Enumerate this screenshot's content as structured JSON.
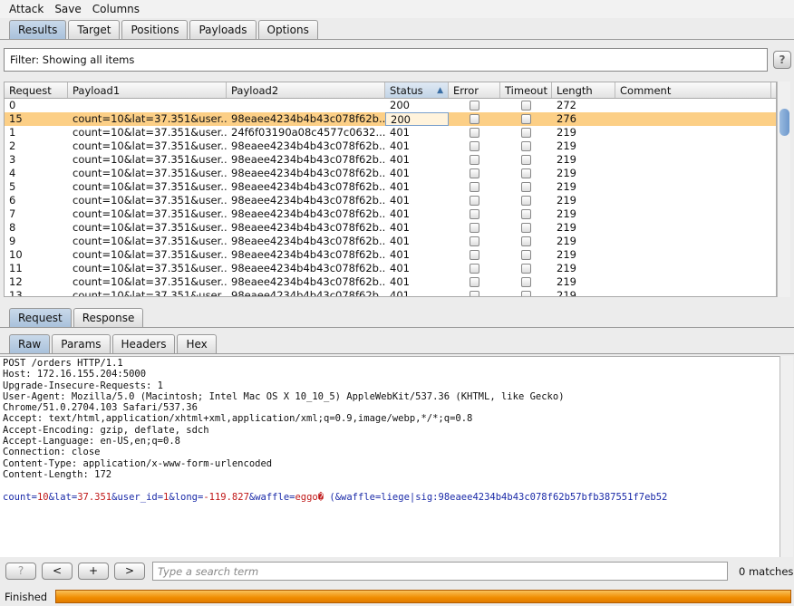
{
  "menu": [
    "Attack",
    "Save",
    "Columns"
  ],
  "main_tabs": [
    {
      "label": "Results",
      "selected": true
    },
    {
      "label": "Target"
    },
    {
      "label": "Positions"
    },
    {
      "label": "Payloads"
    },
    {
      "label": "Options"
    }
  ],
  "filter": "Filter: Showing all items",
  "help_label": "?",
  "table": {
    "columns": [
      "Request",
      "Payload1",
      "Payload2",
      "Status",
      "Error",
      "Timeout",
      "Length",
      "Comment"
    ],
    "sorted_column": "Status",
    "rows": [
      {
        "request": "0",
        "payload1": "",
        "payload2": "",
        "status": "200",
        "length": "272"
      },
      {
        "request": "15",
        "payload1": "count=10&lat=37.351&user...",
        "payload2": "98eaee4234b4b43c078f62b...",
        "status": "200",
        "length": "276",
        "selected": true
      },
      {
        "request": "1",
        "payload1": "count=10&lat=37.351&user...",
        "payload2": "24f6f03190a08c4577c0632...",
        "status": "401",
        "length": "219"
      },
      {
        "request": "2",
        "payload1": "count=10&lat=37.351&user...",
        "payload2": "98eaee4234b4b43c078f62b...",
        "status": "401",
        "length": "219"
      },
      {
        "request": "3",
        "payload1": "count=10&lat=37.351&user...",
        "payload2": "98eaee4234b4b43c078f62b...",
        "status": "401",
        "length": "219"
      },
      {
        "request": "4",
        "payload1": "count=10&lat=37.351&user...",
        "payload2": "98eaee4234b4b43c078f62b...",
        "status": "401",
        "length": "219"
      },
      {
        "request": "5",
        "payload1": "count=10&lat=37.351&user...",
        "payload2": "98eaee4234b4b43c078f62b...",
        "status": "401",
        "length": "219"
      },
      {
        "request": "6",
        "payload1": "count=10&lat=37.351&user...",
        "payload2": "98eaee4234b4b43c078f62b...",
        "status": "401",
        "length": "219"
      },
      {
        "request": "7",
        "payload1": "count=10&lat=37.351&user...",
        "payload2": "98eaee4234b4b43c078f62b...",
        "status": "401",
        "length": "219"
      },
      {
        "request": "8",
        "payload1": "count=10&lat=37.351&user...",
        "payload2": "98eaee4234b4b43c078f62b...",
        "status": "401",
        "length": "219"
      },
      {
        "request": "9",
        "payload1": "count=10&lat=37.351&user...",
        "payload2": "98eaee4234b4b43c078f62b...",
        "status": "401",
        "length": "219"
      },
      {
        "request": "10",
        "payload1": "count=10&lat=37.351&user...",
        "payload2": "98eaee4234b4b43c078f62b...",
        "status": "401",
        "length": "219"
      },
      {
        "request": "11",
        "payload1": "count=10&lat=37.351&user...",
        "payload2": "98eaee4234b4b43c078f62b...",
        "status": "401",
        "length": "219"
      },
      {
        "request": "12",
        "payload1": "count=10&lat=37.351&user...",
        "payload2": "98eaee4234b4b43c078f62b...",
        "status": "401",
        "length": "219"
      },
      {
        "request": "13",
        "payload1": "count=10&lat=37.351&user...",
        "payload2": "98eaee4234b4b43c078f62b...",
        "status": "401",
        "length": "219"
      }
    ]
  },
  "req_tabs": [
    {
      "label": "Request",
      "selected": true
    },
    {
      "label": "Response"
    }
  ],
  "view_tabs": [
    {
      "label": "Raw",
      "selected": true
    },
    {
      "label": "Params"
    },
    {
      "label": "Headers"
    },
    {
      "label": "Hex"
    }
  ],
  "raw_headers": [
    "POST /orders HTTP/1.1",
    "Host: 172.16.155.204:5000",
    "Upgrade-Insecure-Requests: 1",
    "User-Agent: Mozilla/5.0 (Macintosh; Intel Mac OS X 10_10_5) AppleWebKit/537.36 (KHTML, like Gecko)",
    "Chrome/51.0.2704.103 Safari/537.36",
    "Accept: text/html,application/xhtml+xml,application/xml;q=0.9,image/webp,*/*;q=0.8",
    "Accept-Encoding: gzip, deflate, sdch",
    "Accept-Language: en-US,en;q=0.8",
    "Connection: close",
    "Content-Type: application/x-www-form-urlencoded",
    "Content-Length: 172"
  ],
  "raw_body": [
    {
      "k": "count="
    },
    {
      "v": "10"
    },
    {
      "k": "&lat="
    },
    {
      "v": "37.351"
    },
    {
      "k": "&user_id="
    },
    {
      "v": "1"
    },
    {
      "k": "&long="
    },
    {
      "v": "-119.827"
    },
    {
      "k": "&waffle="
    },
    {
      "v": "eggo�"
    },
    {
      "k": " (&waffle=liege|sig:98eaee4234b4b43c078f62b57bfb387551f7eb52"
    }
  ],
  "search": {
    "buttons": [
      "?",
      "<",
      "+",
      ">"
    ],
    "placeholder": "Type a search term",
    "matches": "0 matches"
  },
  "status": {
    "label": "Finished",
    "progress_percent": 100
  },
  "colors": {
    "selected_row": "#fccf86",
    "progress": "#f08c00",
    "key": "#1a2aa8",
    "value": "#c01818"
  }
}
